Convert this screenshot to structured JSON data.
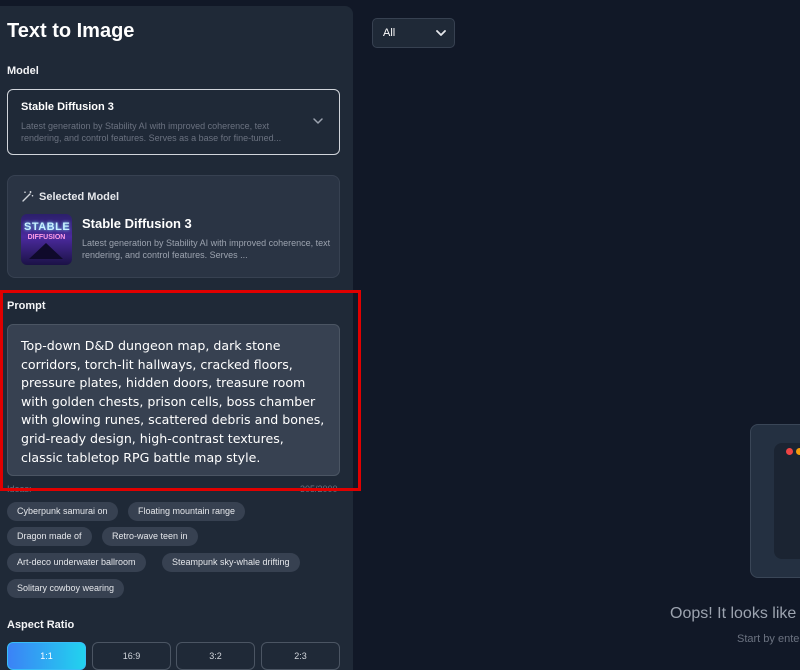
{
  "panel": {
    "title": "Text to Image",
    "model_label": "Model",
    "model_select": {
      "name": "Stable Diffusion 3",
      "desc": "Latest generation by Stability AI with improved coherence, text rendering, and control features. Serves as a base for fine-tuned..."
    },
    "selected": {
      "header": "Selected Model",
      "thumb_line1": "STABLE",
      "thumb_line2": "DIFFUSION",
      "name": "Stable Diffusion 3",
      "desc": "Latest generation by Stability AI with improved coherence, text rendering, and control features. Serves ..."
    },
    "prompt_label": "Prompt",
    "prompt_text": "Top-down D&D dungeon map, dark stone corridors, torch-lit hallways, cracked floors, pressure plates, hidden doors, treasure room with golden chests, prison cells, boss chamber with glowing runes, scattered debris and bones, grid-ready design, high-contrast textures, classic tabletop RPG battle map style.",
    "ideas_label": "Ideas:",
    "char_counter": "305/2000",
    "ideas": [
      "Cyberpunk samurai on",
      "Floating mountain range",
      "Dragon made of",
      "Retro-wave teen in",
      "Art-deco underwater ballroom",
      "Steampunk sky-whale drifting",
      "Solitary cowboy wearing"
    ],
    "aspect_label": "Aspect Ratio",
    "aspect_ratios": [
      "1:1",
      "16:9",
      "3:2",
      "2:3"
    ],
    "aspect_selected": "1:1"
  },
  "gallery": {
    "filter_value": "All",
    "empty_title": "Oops! It looks like",
    "empty_sub": "Start by ente"
  },
  "colors": {
    "background": "#111827",
    "panel": "#1f2937",
    "highlight": "#e00000",
    "accent_start": "#3b82f6",
    "accent_end": "#22d3ee"
  },
  "icons": {
    "model_dropdown": "chevron-down-icon",
    "selected_header": "magic-wand-icon",
    "filter": "caret-down-icon"
  }
}
